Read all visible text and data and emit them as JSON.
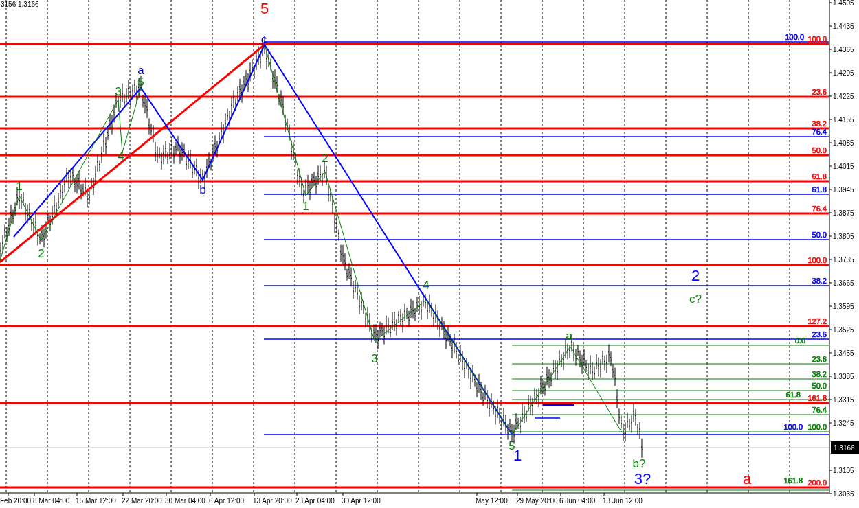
{
  "header": {
    "text": "3156 1.3166"
  },
  "price_axis": {
    "labels": [
      "1.4505",
      "1.4435",
      "1.4365",
      "1.4295",
      "1.4225",
      "1.4155",
      "1.4085",
      "1.4015",
      "1.3945",
      "1.3875",
      "1.3805",
      "1.3735",
      "1.3665",
      "1.3595",
      "1.3525",
      "1.3455",
      "1.3385",
      "1.3315",
      "1.3245",
      "1.3105",
      "1.3035"
    ],
    "current_price": "1.3166"
  },
  "time_axis": {
    "labels": [
      "Feb 20:00",
      "8 Mar 04:00",
      "15 Mar 12:00",
      "22 Mar 20:00",
      "30 Mar 04:00",
      "6 Apr 12:00",
      "13 Apr 20:00",
      "23 Apr 04:00",
      "30 Apr 12:00",
      "May 12:00",
      "29 May 20:00",
      "6 Jun 04:00",
      "13 Jun 12:00"
    ]
  },
  "fib_levels": [
    {
      "label": "100.0",
      "color": "#0000ff",
      "kind": "middle"
    },
    {
      "label": "100.0",
      "color": "#ff0000",
      "kind": "major"
    },
    {
      "label": "23.6",
      "color": "#ff0000",
      "kind": "major"
    },
    {
      "label": "38.2",
      "color": "#ff0000",
      "kind": "major"
    },
    {
      "label": "76.4",
      "color": "#0000ff",
      "kind": "middle"
    },
    {
      "label": "50.0",
      "color": "#ff0000",
      "kind": "major"
    },
    {
      "label": "61.8",
      "color": "#ff0000",
      "kind": "major"
    },
    {
      "label": "61.8",
      "color": "#0000ff",
      "kind": "middle"
    },
    {
      "label": "76.4",
      "color": "#ff0000",
      "kind": "major"
    },
    {
      "label": "50.0",
      "color": "#0000ff",
      "kind": "middle"
    },
    {
      "label": "100.0",
      "color": "#ff0000",
      "kind": "major"
    },
    {
      "label": "38.2",
      "color": "#0000ff",
      "kind": "middle"
    },
    {
      "label": "127.2",
      "color": "#ff0000",
      "kind": "major"
    },
    {
      "label": "23.6",
      "color": "#0000ff",
      "kind": "middle"
    },
    {
      "label": "0.0",
      "color": "#008000",
      "kind": "minor"
    },
    {
      "label": "23.6",
      "color": "#008000",
      "kind": "minor"
    },
    {
      "label": "38.2",
      "color": "#008000",
      "kind": "minor"
    },
    {
      "label": "50.0",
      "color": "#008000",
      "kind": "minor"
    },
    {
      "label": "61.8",
      "color": "#008000",
      "kind": "minor"
    },
    {
      "label": "161.8",
      "color": "#ff0000",
      "kind": "major"
    },
    {
      "label": "76.4",
      "color": "#008000",
      "kind": "minor"
    },
    {
      "label": "100.0",
      "color": "#0000ff",
      "kind": "middle"
    },
    {
      "label": "100.0",
      "color": "#008000",
      "kind": "minor"
    },
    {
      "label": "161.8",
      "color": "#008000",
      "kind": "minor"
    },
    {
      "label": "200.0",
      "color": "#ff0000",
      "kind": "major"
    }
  ],
  "wave_labels": [
    {
      "text": "5",
      "color": "#ff0000",
      "kind": "large"
    },
    {
      "text": "c",
      "color": "#0000ff",
      "kind": "medium"
    },
    {
      "text": "a",
      "color": "#0000ff",
      "kind": "medium"
    },
    {
      "text": "5",
      "color": "#008000",
      "kind": "medium"
    },
    {
      "text": "3",
      "color": "#008000",
      "kind": "medium"
    },
    {
      "text": "4",
      "color": "#008000",
      "kind": "medium"
    },
    {
      "text": "1",
      "color": "#008000",
      "kind": "medium"
    },
    {
      "text": "2",
      "color": "#008000",
      "kind": "medium"
    },
    {
      "text": "b",
      "color": "#0000ff",
      "kind": "medium"
    },
    {
      "text": "2",
      "color": "#008000",
      "kind": "medium"
    },
    {
      "text": "1",
      "color": "#008000",
      "kind": "medium"
    },
    {
      "text": "4",
      "color": "#008000",
      "kind": "medium"
    },
    {
      "text": "3",
      "color": "#008000",
      "kind": "medium"
    },
    {
      "text": "5",
      "color": "#008000",
      "kind": "medium"
    },
    {
      "text": "1",
      "color": "#0000ff",
      "kind": "large"
    },
    {
      "text": "a",
      "color": "#008000",
      "kind": "medium"
    },
    {
      "text": "b?",
      "color": "#008000",
      "kind": "medium"
    },
    {
      "text": "3?",
      "color": "#0000ff",
      "kind": "large"
    },
    {
      "text": "2",
      "color": "#0000ff",
      "kind": "large"
    },
    {
      "text": "c?",
      "color": "#008000",
      "kind": "medium"
    },
    {
      "text": "a",
      "color": "#ff0000",
      "kind": "large"
    }
  ]
}
